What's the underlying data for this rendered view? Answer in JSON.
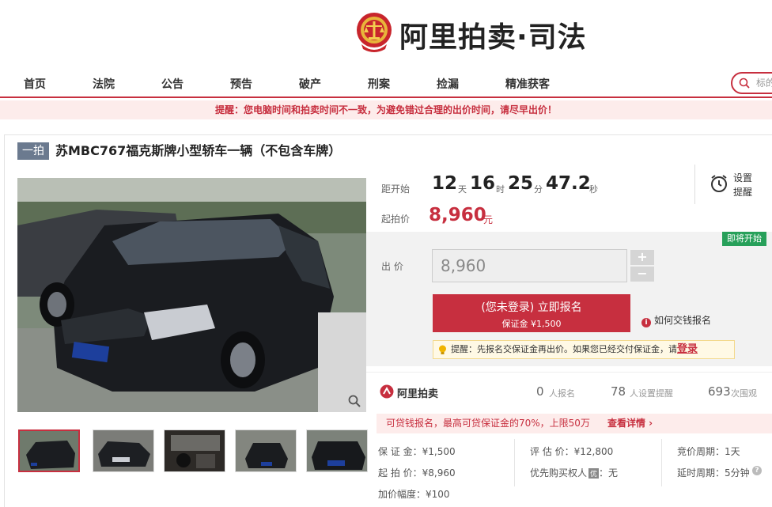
{
  "logo": {
    "text": "阿里拍卖·司法"
  },
  "nav": {
    "items": [
      "首页",
      "法院",
      "公告",
      "预告",
      "破产",
      "刑案",
      "捡漏",
      "精准获客"
    ]
  },
  "search": {
    "placeholder": "标的"
  },
  "notice": "提醒：您电脑时间和拍卖时间不一致，为避免错过合理的出价时间，请尽早出价！",
  "item": {
    "tag": "一拍",
    "title": "苏MBC767福克斯牌小型轿车一辆（不包含车牌）"
  },
  "countdown": {
    "label": "距开始",
    "days": "12",
    "days_unit": "天",
    "hours": "16",
    "hours_unit": "时",
    "minutes": "25",
    "minutes_unit": "分",
    "seconds": "47.2",
    "seconds_unit": "秒"
  },
  "start_price": {
    "label": "起拍价",
    "value": "8,960",
    "unit": "元"
  },
  "reminder": {
    "line1": "设置",
    "line2": "提醒"
  },
  "status_badge": "即将开始",
  "bid": {
    "label": "出 价",
    "value": "8,960",
    "plus": "+",
    "minus": "−",
    "cta_line1": "(您未登录) 立即报名",
    "cta_line2": "保证金 ¥1,500",
    "how_to": "如何交钱报名",
    "tip_text": "提醒：先报名交保证金再出价。如果您已经交付保证金，请",
    "tip_login": "登录"
  },
  "stats": {
    "brand": "阿里拍卖",
    "enrolled": "0",
    "enrolled_label": "人报名",
    "reminders": "78",
    "reminders_label": "人设置提醒",
    "views": "693",
    "views_label": "次围观"
  },
  "promo": {
    "text": "可贷钱报名，最高可贷保证金的70%，上限50万",
    "more": "查看详情 ›"
  },
  "details": {
    "deposit": "保 证 金：¥1,500",
    "start": "起 拍 价：¥8,960",
    "increment": "加价幅度：¥100",
    "appraisal": "评 估 价：¥12,800",
    "priority": "优先购买权人",
    "priority_badge": "优",
    "priority_value": "：无",
    "cycle": "竞价周期：1天",
    "delay": "延时周期：5分钟"
  },
  "colors": {
    "accent": "#c72f3f",
    "green": "#27a05a"
  }
}
